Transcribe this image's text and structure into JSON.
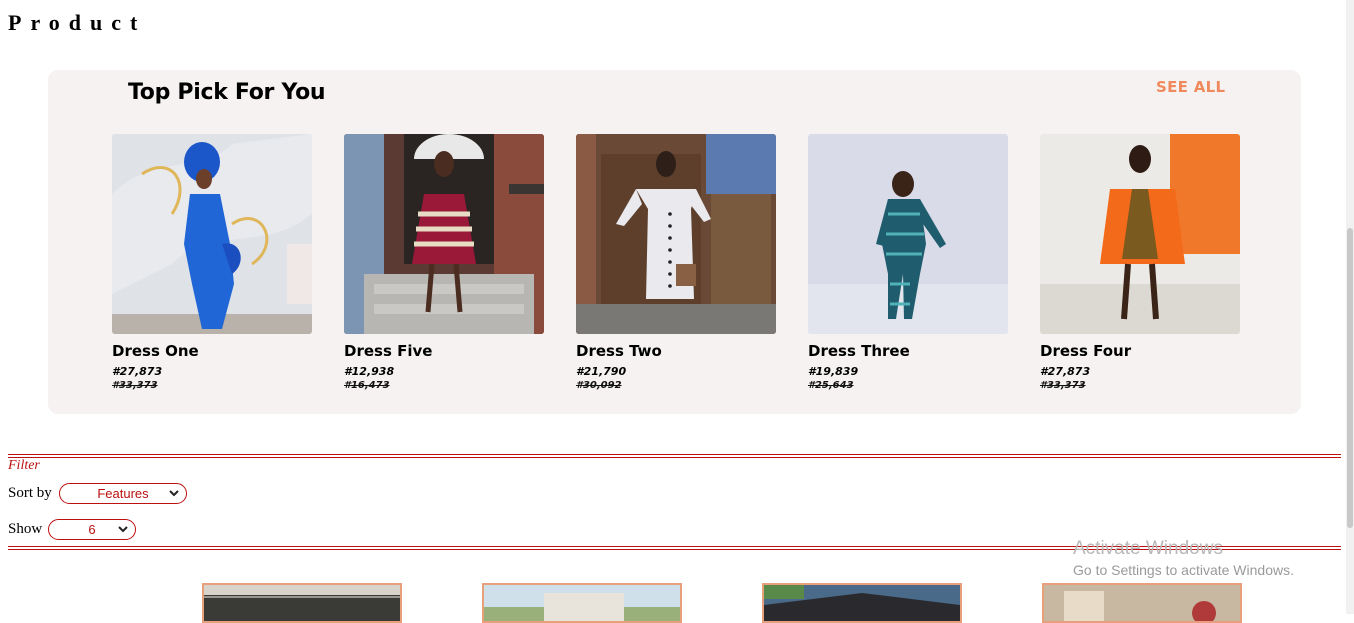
{
  "page": {
    "title": "Product"
  },
  "top_pick": {
    "title": "Top Pick For You",
    "see_all_label": "SEE ALL",
    "products": [
      {
        "name": "Dress One",
        "price": "#27,873",
        "old_price": "#33,373"
      },
      {
        "name": "Dress Five",
        "price": "#12,938",
        "old_price": "#16,473"
      },
      {
        "name": "Dress Two",
        "price": "#21,790",
        "old_price": "#30,092"
      },
      {
        "name": "Dress Three",
        "price": "#19,839",
        "old_price": "#25,643"
      },
      {
        "name": "Dress Four",
        "price": "#27,873",
        "old_price": "#33,373"
      }
    ]
  },
  "filter": {
    "label": "Filter",
    "sort_label": "Sort by",
    "sort_value": "Features",
    "show_label": "Show",
    "show_value": "6"
  },
  "watermark": {
    "title": "Activate Windows",
    "subtitle": "Go to Settings to activate Windows."
  },
  "colors": {
    "accent": "#f08a5d",
    "filter_red": "#bb1111",
    "panel_bg": "#f6f2f2"
  }
}
